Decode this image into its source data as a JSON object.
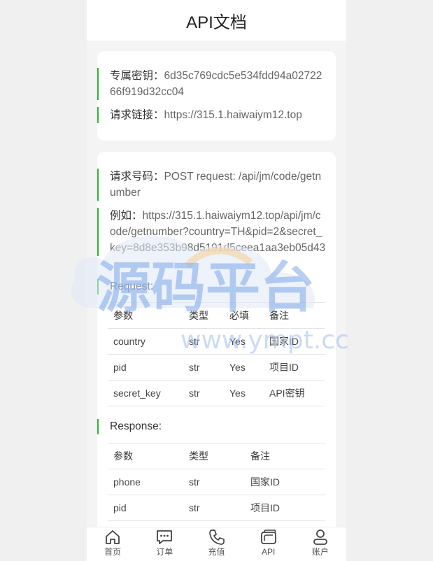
{
  "header": {
    "title": "API文档"
  },
  "card1": {
    "key_label": "专属密钥：",
    "key_value": "6d35c769cdc5e534fdd94a0272266f919d32cc04",
    "link_label": "请求链接：",
    "link_value": "https://315.1.haiwaiym12.top"
  },
  "card2": {
    "req_label": "请求号码：",
    "req_value": "POST request: /api/jm/code/getnumber",
    "example_label": "例如：",
    "example_value": "https://315.1.haiwaiym12.top/api/jm/code/getnumber?country=TH&pid=2&secret_key=8d8e353b98d5191d5ceea1aa3eb05d43",
    "request_title": "Request:",
    "request_headers": [
      "参数",
      "类型",
      "必填",
      "备注"
    ],
    "request_rows": [
      [
        "country",
        "str",
        "Yes",
        "国家ID"
      ],
      [
        "pid",
        "str",
        "Yes",
        "项目ID"
      ],
      [
        "secret_key",
        "str",
        "Yes",
        "API密钥"
      ]
    ],
    "response_title": "Response:",
    "response_headers": [
      "参数",
      "类型",
      "备注"
    ],
    "response_rows": [
      [
        "phone",
        "str",
        "国家ID"
      ],
      [
        "pid",
        "str",
        "项目ID"
      ]
    ]
  },
  "watermark": {
    "text": "源码平台",
    "sub": "www.ympt.cc"
  },
  "tabbar": [
    {
      "label": "首页",
      "icon": "home-icon"
    },
    {
      "label": "订单",
      "icon": "chat-order-icon"
    },
    {
      "label": "充值",
      "icon": "phone-icon"
    },
    {
      "label": "API",
      "icon": "card-icon"
    },
    {
      "label": "账户",
      "icon": "user-icon"
    }
  ]
}
